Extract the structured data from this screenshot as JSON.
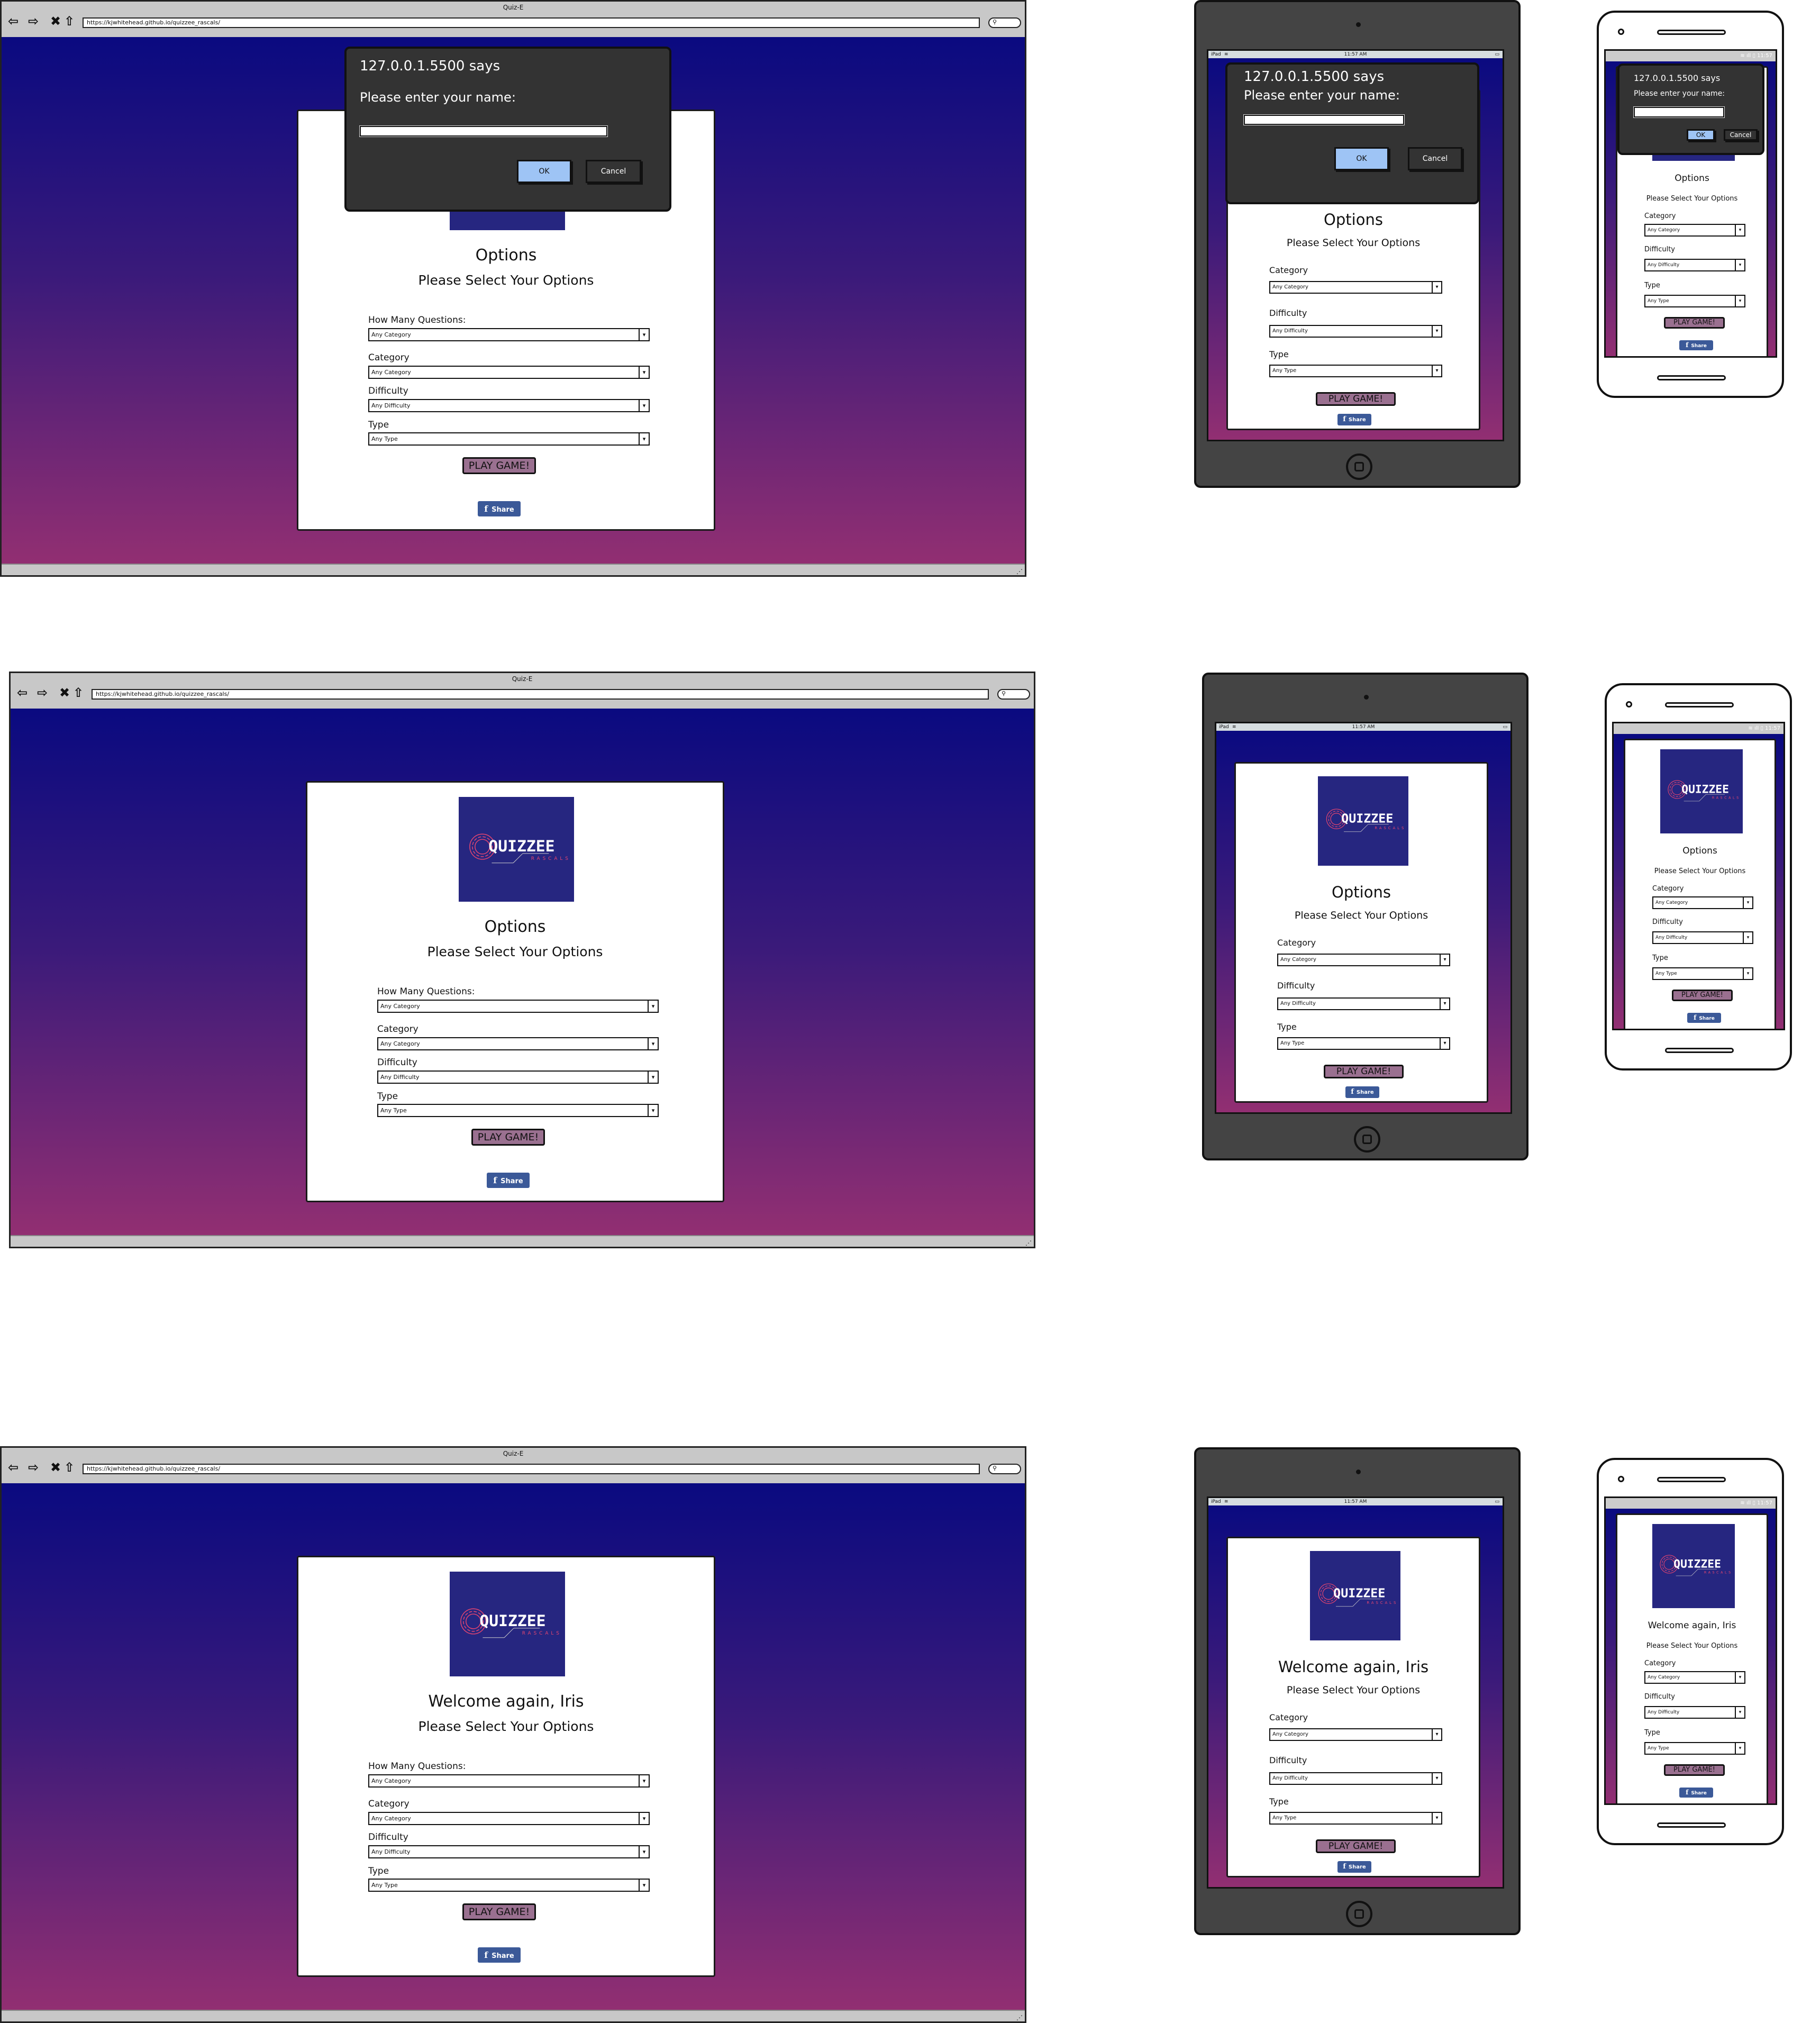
{
  "browser": {
    "title": "Quiz-E",
    "url": "https://kjwhitehead.github.io/quizzee_rascals/",
    "search_icon": "magnifier-icon",
    "nav_icons": [
      "back-arrow-icon",
      "forward-arrow-icon",
      "close-x-icon",
      "home-icon"
    ]
  },
  "tablet_status": {
    "device": "iPad",
    "time": "11:57 AM"
  },
  "phone_status": {
    "time": "11:57"
  },
  "dialog": {
    "title": "127.0.0.1.5500 says",
    "message": "Please enter your name:",
    "input_value": "",
    "ok_label": "OK",
    "cancel_label": "Cancel"
  },
  "logo": {
    "text": "QUIZZEE",
    "subtext": "RASCALS"
  },
  "screens": [
    {
      "heading": "Options",
      "subheading": "Please Select Your Options",
      "dialog_open": true
    },
    {
      "heading": "Options",
      "subheading": "Please Select Your Options",
      "dialog_open": false
    },
    {
      "heading": "Welcome again, Iris",
      "subheading": "Please Select Your Options",
      "dialog_open": false
    }
  ],
  "form": {
    "fields": [
      {
        "label": "How Many Questions:",
        "value": "Any Category",
        "desktop_only": true
      },
      {
        "label": "Category",
        "value": "Any Category",
        "desktop_only": false
      },
      {
        "label": "Difficulty",
        "value": "Any Difficulty",
        "desktop_only": false
      },
      {
        "label": "Type",
        "value": "Any Type",
        "desktop_only": false
      }
    ],
    "play_label": "PLAY GAME!",
    "share_label": "Share",
    "share_icon": "facebook-f-icon"
  },
  "colors": {
    "gradient_top": "#0a0a80",
    "gradient_bottom": "#922f72",
    "play_button": "#9a7090",
    "share_button": "#3b5998",
    "dialog_bg": "#333333",
    "ok_button": "#9ec4f5",
    "logo_bg": "#262680",
    "logo_accent": "#e8456f"
  }
}
